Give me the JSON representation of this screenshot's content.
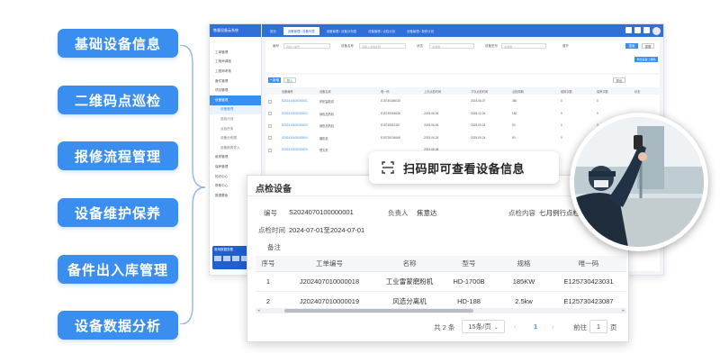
{
  "features": [
    "基础设备信息",
    "二维码点巡检",
    "报修流程管理",
    "设备维护保养",
    "备件出入库管理",
    "设备数据分析"
  ],
  "app": {
    "brand": "售墨设备云系统",
    "tabs": [
      "首页",
      "设备管理 / 设备列表",
      "设备管理 / 设备分布图",
      "设备管理 / 点检计划",
      "设备管理 / 报修计划"
    ],
    "menu": [
      "工单管理",
      "工程师调度",
      "工程师考核",
      "备件管理",
      "项目管理",
      "设备管理",
      "设备管理",
      "巡检计划",
      "点检任务",
      "设备分布图",
      "设备报表导入",
      "维修管理",
      "保养管理",
      "知识中心",
      "帮助中心",
      "数据看板"
    ],
    "filters": {
      "label_code": "编号",
      "label_name": "设备名称",
      "label_status": "状态",
      "label_model": "设备型号",
      "ph_code": "请输入编号",
      "ph_name": "请输入设备名称",
      "ph_select": "请选择",
      "more": "展开",
      "search": "搜索",
      "reset": "重置",
      "export": "导出设备二维码"
    },
    "toolbar": {
      "add": "+ 新增",
      "import": "导入",
      "export": "导出"
    },
    "columns": [
      "设备编号",
      "设备名称",
      "唯一码",
      "上次点检时间",
      "下次点检时间",
      "点检周期",
      "维修次数",
      "保养次数",
      "状态"
    ],
    "rows": [
      [
        "S202410100000001",
        "炉机智能烘",
        "E15740345033",
        "",
        "2024-06-07",
        "360",
        "0",
        "0"
      ],
      [
        "S202410100000002",
        "绿色加热机",
        "E15740344838",
        "2025-06-06",
        "2025-12-05",
        "180",
        "0",
        "0"
      ],
      [
        "S202410100000003",
        "绿色加热机",
        "E15740512387",
        "2025-06-06",
        "2025-09-04",
        "90",
        "0",
        "0"
      ],
      [
        "S202410100000004",
        "磨机机",
        "E15728134068",
        "2025-06-26",
        "2025-09-24",
        "90",
        "0",
        "0"
      ],
      [
        "S202410100000005",
        "预灭机",
        "",
        "2024-06-08",
        "",
        "",
        "",
        ""
      ]
    ],
    "promo": "常用数据查看"
  },
  "bubble": {
    "icon": "scan-icon",
    "text": "扫码即可查看设备信息"
  },
  "card": {
    "title": "点检设备",
    "code_label": "编号",
    "code": "S2024070100000001",
    "owner_label": "负责人",
    "owner": "焦意达",
    "content_label": "点检内容",
    "content": "七月例行点检",
    "time_label": "点检时间",
    "time": "2024-07-01至2024-07-01",
    "remark_label": "备注",
    "columns": [
      "序号",
      "工单编号",
      "名称",
      "型号",
      "规格",
      "唯一码"
    ],
    "rows": [
      [
        "1",
        "J202407010000018",
        "工业雷蒙磨粉机",
        "HD-1700B",
        "185KW",
        "E125730423031"
      ],
      [
        "2",
        "J202407010000019",
        "风选分离机",
        "HD-188",
        "2.5kw",
        "E125730423087"
      ]
    ],
    "total": "共 2 条",
    "page_size": "15条/页",
    "current_page": "1",
    "goto_label": "前往",
    "goto_value": "1",
    "page_unit": "页"
  },
  "colors": {
    "accent": "#3a8ef0",
    "header": "#2f6fd8"
  }
}
